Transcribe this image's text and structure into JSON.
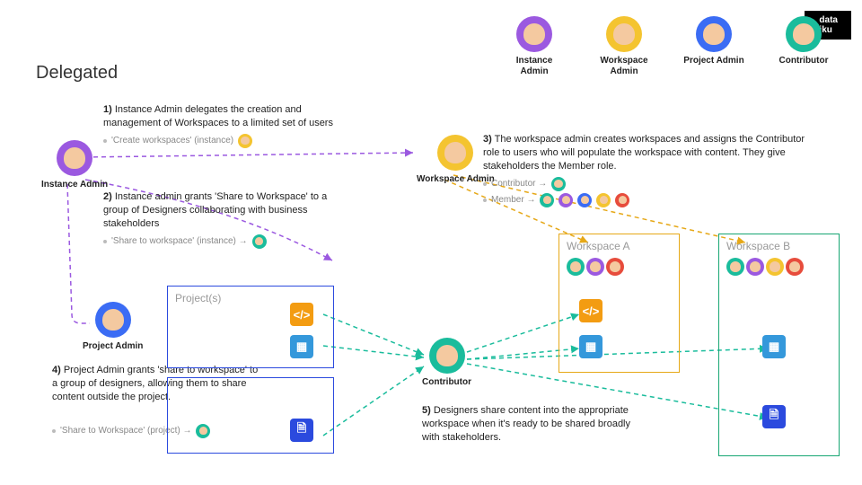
{
  "title": "Delegated",
  "logo": "data iku",
  "legend": [
    {
      "label": "Instance Admin",
      "color": "purple"
    },
    {
      "label": "Workspace Admin",
      "color": "yellow"
    },
    {
      "label": "Project Admin",
      "color": "blue"
    },
    {
      "label": "Contributor",
      "color": "teal"
    }
  ],
  "nodes": {
    "instance_admin": {
      "label": "Instance Admin",
      "color": "purple"
    },
    "workspace_admin": {
      "label": "Workspace Admin",
      "color": "yellow"
    },
    "project_admin": {
      "label": "Project Admin",
      "color": "blue"
    },
    "contributor": {
      "label": "Contributor",
      "color": "teal"
    }
  },
  "steps": {
    "s1": {
      "num": "1)",
      "text": "Instance Admin delegates the creation and management of Workspaces to a limited set of users"
    },
    "s1_perm": "'Create workspaces' (instance)",
    "s2": {
      "num": "2)",
      "text": "Instance admin grants 'Share to Workspace' to a group of Designers collaborating with business stakeholders"
    },
    "s2_perm": "'Share to workspace' (instance) →",
    "s3": {
      "num": "3)",
      "text": "The workspace admin creates workspaces and assigns the Contributor role to users who will populate the workspace with content. They give stakeholders the Member role."
    },
    "s3_perm1": "Contributor →",
    "s3_perm2": "Member →",
    "s4": {
      "num": "4)",
      "text": "Project Admin grants 'share to workspace' to a group of designers, allowing them to share content outside the project."
    },
    "s4_perm": "'Share to Workspace' (project) →",
    "s5": {
      "num": "5)",
      "text": "Designers share content into the appropriate workspace when it's ready to be shared broadly with stakeholders."
    }
  },
  "boxes": {
    "projects": "Project(s)",
    "wsa": "Workspace A",
    "wsb": "Workspace B"
  },
  "icons": {
    "code": "</>",
    "grid": "▦",
    "doc": "🗎"
  }
}
